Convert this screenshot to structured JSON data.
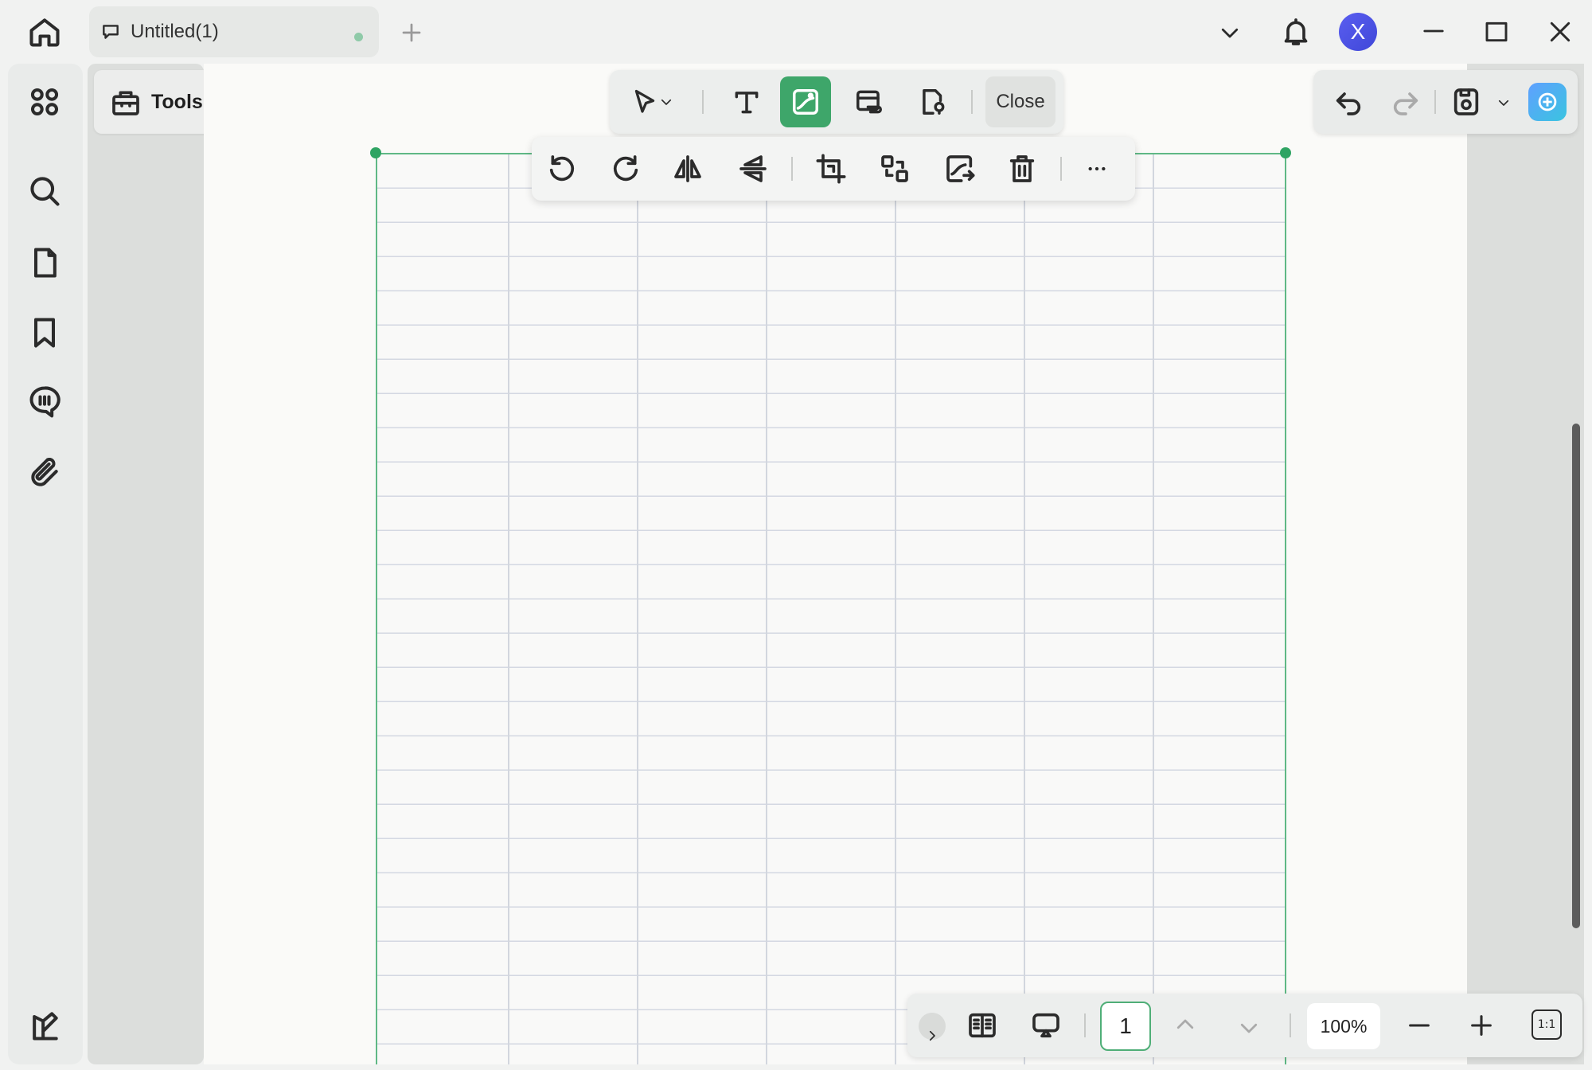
{
  "window": {
    "tab_title": "Untitled(1)",
    "avatar_letter": "X"
  },
  "sidebar": {
    "items": [
      "home-icon",
      "apps-icon",
      "search-icon",
      "page-icon",
      "bookmark-icon",
      "comment-icon",
      "attachment-icon",
      "theme-icon"
    ]
  },
  "tools": {
    "label": "Tools"
  },
  "toolbar": {
    "close_label": "Close",
    "items": [
      "select-tool",
      "text-tool",
      "image-tool",
      "link-tool",
      "stamp-tool"
    ]
  },
  "image_toolbar": {
    "items": [
      "rotate-left",
      "rotate-right",
      "flip-horizontal",
      "flip-vertical",
      "crop",
      "replace",
      "extract",
      "delete",
      "more"
    ]
  },
  "bottom_bar": {
    "page_number": "1",
    "zoom": "100%",
    "fit_label": "1:1"
  },
  "colors": {
    "accent": "#3ea66a",
    "avatar": "#4a4fe3"
  }
}
